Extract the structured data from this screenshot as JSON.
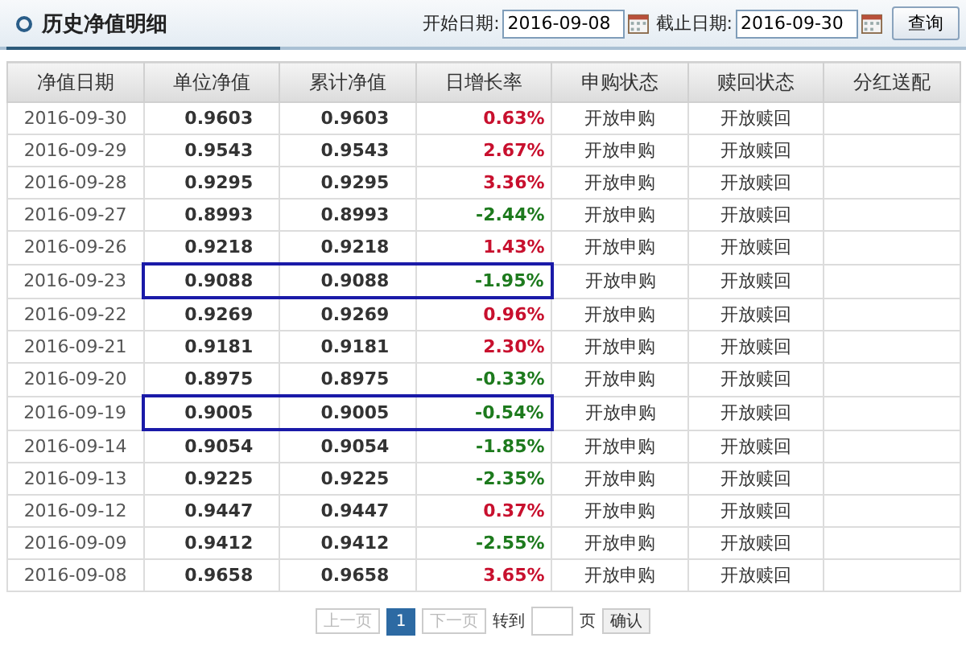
{
  "title": "历史净值明细",
  "filters": [
    {
      "label": "开始日期:",
      "value": "2016-09-08"
    },
    {
      "label": "截止日期:",
      "value": "2016-09-30"
    }
  ],
  "search_button": "查询",
  "table": {
    "columns": [
      "净值日期",
      "单位净值",
      "累计净值",
      "日增长率",
      "申购状态",
      "赎回状态",
      "分红送配"
    ],
    "rows": [
      {
        "date": "2016-09-30",
        "nav": "0.9603",
        "acc": "0.9603",
        "change": "0.63%",
        "color": "#c8102e",
        "buy": "开放申购",
        "redeem": "开放赎回",
        "highlighted": false
      },
      {
        "date": "2016-09-29",
        "nav": "0.9543",
        "acc": "0.9543",
        "change": "2.67%",
        "color": "#c8102e",
        "buy": "开放申购",
        "redeem": "开放赎回",
        "highlighted": false
      },
      {
        "date": "2016-09-28",
        "nav": "0.9295",
        "acc": "0.9295",
        "change": "3.36%",
        "color": "#c8102e",
        "buy": "开放申购",
        "redeem": "开放赎回",
        "highlighted": false
      },
      {
        "date": "2016-09-27",
        "nav": "0.8993",
        "acc": "0.8993",
        "change": "-2.44%",
        "color": "#1d7a1d",
        "buy": "开放申购",
        "redeem": "开放赎回",
        "highlighted": false
      },
      {
        "date": "2016-09-26",
        "nav": "0.9218",
        "acc": "0.9218",
        "change": "1.43%",
        "color": "#c8102e",
        "buy": "开放申购",
        "redeem": "开放赎回",
        "highlighted": false
      },
      {
        "date": "2016-09-23",
        "nav": "0.9088",
        "acc": "0.9088",
        "change": "-1.95%",
        "color": "#1d7a1d",
        "buy": "开放申购",
        "redeem": "开放赎回",
        "highlighted": true
      },
      {
        "date": "2016-09-22",
        "nav": "0.9269",
        "acc": "0.9269",
        "change": "0.96%",
        "color": "#c8102e",
        "buy": "开放申购",
        "redeem": "开放赎回",
        "highlighted": false
      },
      {
        "date": "2016-09-21",
        "nav": "0.9181",
        "acc": "0.9181",
        "change": "2.30%",
        "color": "#c8102e",
        "buy": "开放申购",
        "redeem": "开放赎回",
        "highlighted": false
      },
      {
        "date": "2016-09-20",
        "nav": "0.8975",
        "acc": "0.8975",
        "change": "-0.33%",
        "color": "#1d7a1d",
        "buy": "开放申购",
        "redeem": "开放赎回",
        "highlighted": false
      },
      {
        "date": "2016-09-19",
        "nav": "0.9005",
        "acc": "0.9005",
        "change": "-0.54%",
        "color": "#1d7a1d",
        "buy": "开放申购",
        "redeem": "开放赎回",
        "highlighted": true
      },
      {
        "date": "2016-09-14",
        "nav": "0.9054",
        "acc": "0.9054",
        "change": "-1.85%",
        "color": "#1d7a1d",
        "buy": "开放申购",
        "redeem": "开放赎回",
        "highlighted": false
      },
      {
        "date": "2016-09-13",
        "nav": "0.9225",
        "acc": "0.9225",
        "change": "-2.35%",
        "color": "#1d7a1d",
        "buy": "开放申购",
        "redeem": "开放赎回",
        "highlighted": false
      },
      {
        "date": "2016-09-12",
        "nav": "0.9447",
        "acc": "0.9447",
        "change": "0.37%",
        "color": "#c8102e",
        "buy": "开放申购",
        "redeem": "开放赎回",
        "highlighted": false
      },
      {
        "date": "2016-09-09",
        "nav": "0.9412",
        "acc": "0.9412",
        "change": "-2.55%",
        "color": "#1d7a1d",
        "buy": "开放申购",
        "redeem": "开放赎回",
        "highlighted": false
      },
      {
        "date": "2016-09-08",
        "nav": "0.9658",
        "acc": "0.9658",
        "change": "3.65%",
        "color": "#c8102e",
        "buy": "开放申购",
        "redeem": "开放赎回",
        "highlighted": false
      }
    ]
  },
  "pagination": {
    "prev": {
      "label": "上一页",
      "disabled": true
    },
    "pages": [
      {
        "label": "1",
        "selected": true
      }
    ],
    "next": {
      "label": "下一页",
      "disabled": true
    },
    "goto_label": "转到",
    "page_unit": "页",
    "confirm": "确认"
  }
}
